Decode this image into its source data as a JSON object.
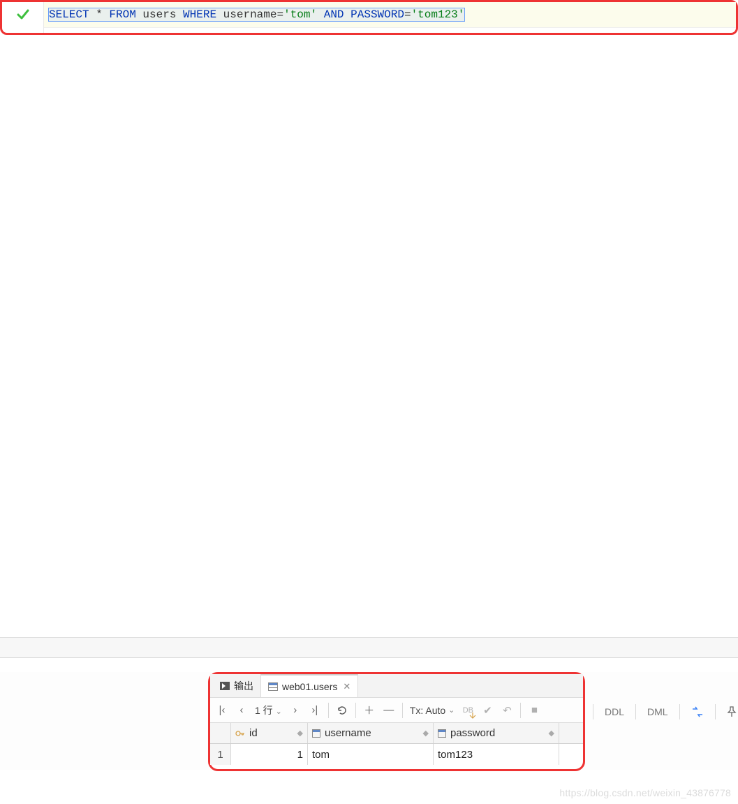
{
  "sql": {
    "tokens": [
      "SELECT",
      " * ",
      "FROM",
      " users ",
      "WHERE",
      " username",
      "=",
      "'tom'",
      " ",
      "AND",
      " ",
      "PASSWORD",
      "=",
      "'tom123'"
    ]
  },
  "tabs": {
    "output_label": "输出",
    "result_tab_label": "web01.users"
  },
  "toolbar": {
    "row_label": "1 行",
    "tx_label": "Tx: Auto"
  },
  "right_toolbar": {
    "ddl": "DDL",
    "dml": "DML"
  },
  "table": {
    "columns": [
      "id",
      "username",
      "password"
    ],
    "rows": [
      {
        "rownum": "1",
        "id": "1",
        "username": "tom",
        "password": "tom123"
      }
    ]
  },
  "watermark": "https://blog.csdn.net/weixin_43876778"
}
